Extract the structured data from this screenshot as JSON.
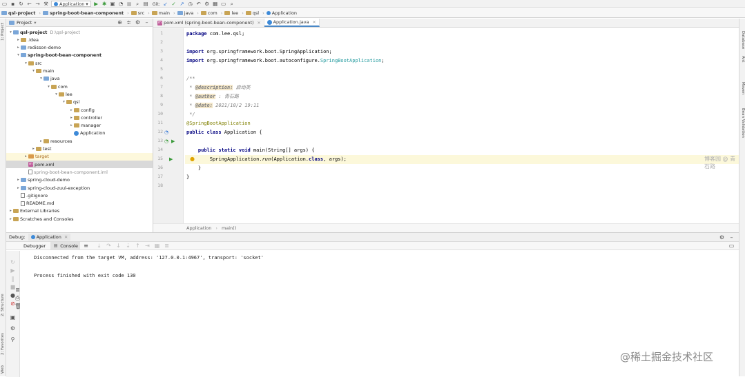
{
  "toolbar": {
    "run_config": "Application",
    "git_label": "Git:"
  },
  "navbar": {
    "crumbs": [
      "qsl-project",
      "spring-boot-bean-component",
      "src",
      "main",
      "java",
      "com",
      "lee",
      "qsl",
      "Application"
    ]
  },
  "project_panel": {
    "title": "Project",
    "tree": [
      {
        "label": "qsl-project",
        "sub": "D:\\qsl-project",
        "indent": 0,
        "arrow": "▾",
        "icon": "folder-blue",
        "bold": true
      },
      {
        "label": ".idea",
        "indent": 1,
        "arrow": "▸",
        "icon": "folder"
      },
      {
        "label": "redisson-demo",
        "indent": 1,
        "arrow": "▸",
        "icon": "folder-blue"
      },
      {
        "label": "spring-boot-bean-component",
        "indent": 1,
        "arrow": "▾",
        "icon": "folder-blue",
        "bold": true
      },
      {
        "label": "src",
        "indent": 2,
        "arrow": "▾",
        "icon": "folder"
      },
      {
        "label": "main",
        "indent": 3,
        "arrow": "▾",
        "icon": "folder"
      },
      {
        "label": "java",
        "indent": 4,
        "arrow": "▾",
        "icon": "folder-blue"
      },
      {
        "label": "com",
        "indent": 5,
        "arrow": "▾",
        "icon": "folder"
      },
      {
        "label": "lee",
        "indent": 6,
        "arrow": "▾",
        "icon": "folder"
      },
      {
        "label": "qsl",
        "indent": 7,
        "arrow": "▾",
        "icon": "folder"
      },
      {
        "label": "config",
        "indent": 8,
        "arrow": "▸",
        "icon": "folder"
      },
      {
        "label": "controller",
        "indent": 8,
        "arrow": "▸",
        "icon": "folder"
      },
      {
        "label": "manager",
        "indent": 8,
        "arrow": "▸",
        "icon": "folder"
      },
      {
        "label": "Application",
        "indent": 8,
        "arrow": "",
        "icon": "java"
      },
      {
        "label": "resources",
        "indent": 4,
        "arrow": "▸",
        "icon": "folder"
      },
      {
        "label": "test",
        "indent": 3,
        "arrow": "▸",
        "icon": "folder"
      },
      {
        "label": "target",
        "indent": 2,
        "arrow": "▸",
        "icon": "folder-orange",
        "style": "orange",
        "hl": true
      },
      {
        "label": "pom.xml",
        "indent": 2,
        "arrow": "",
        "icon": "maven",
        "sel": true
      },
      {
        "label": "spring-boot-bean-component.iml",
        "indent": 2,
        "arrow": "",
        "icon": "text",
        "style": "grey"
      },
      {
        "label": "spring-cloud-demo",
        "indent": 1,
        "arrow": "▸",
        "icon": "folder-blue"
      },
      {
        "label": "spring-cloud-zuul-exception",
        "indent": 1,
        "arrow": "▸",
        "icon": "folder-blue"
      },
      {
        "label": ".gitignore",
        "indent": 1,
        "arrow": "",
        "icon": "text"
      },
      {
        "label": "README.md",
        "indent": 1,
        "arrow": "",
        "icon": "text"
      },
      {
        "label": "External Libraries",
        "indent": 0,
        "arrow": "▸",
        "icon": "folder"
      },
      {
        "label": "Scratches and Consoles",
        "indent": 0,
        "arrow": "▸",
        "icon": "folder"
      }
    ]
  },
  "editor": {
    "tabs": [
      {
        "label": "pom.xml (spring-boot-bean-component)",
        "active": false
      },
      {
        "label": "Application.java",
        "active": true
      }
    ],
    "line_numbers": [
      "1",
      "2",
      "3",
      "4",
      "5",
      "6",
      "7",
      "8",
      "9",
      "10",
      "11",
      "12",
      "13",
      "14",
      "15",
      "16",
      "17",
      "18"
    ],
    "code": {
      "l1_kw": "package",
      "l1_rest": " com.lee.qsl;",
      "l3_kw": "import",
      "l3_rest": " org.springframework.boot.SpringApplication;",
      "l4_kw": "import",
      "l4_rest": " org.springframework.boot.autoconfigure.",
      "l4_type": "SpringBootApplication",
      "l4_end": ";",
      "l6": "/**",
      "l7_star": " * ",
      "l7_tag": "@description:",
      "l7_text": " 启动类",
      "l8_star": " * ",
      "l8_tag": "@author",
      "l8_text": " : 青石路",
      "l9_star": " * ",
      "l9_tag": "@date:",
      "l9_text": " 2021/10/2 19:11",
      "l10": " */",
      "l11": "@SpringBootApplication",
      "l12_kw": "public class",
      "l12_rest": " Application {",
      "l14_indent": "    ",
      "l14_kw": "public static void",
      "l14_rest": " main(String[] args) {",
      "l15_indent": "        ",
      "l15_a": "SpringApplication.",
      "l15_run": "run",
      "l15_b": "(Application.",
      "l15_kw": "class",
      "l15_c": ", args);",
      "l16": "    }",
      "l17": "}"
    },
    "breadcrumb": [
      "Application",
      "main()"
    ],
    "watermark": "博客园 @ 青石路"
  },
  "debug": {
    "label": "Debug:",
    "run_tab": "Application",
    "sub_tabs": [
      "Debugger",
      "Console"
    ],
    "console_lines": [
      "Disconnected from the target VM, address: '127.0.0.1:4967', transport: 'socket'",
      "Process finished with exit code 130"
    ]
  },
  "side_strips": {
    "left": [
      "1: Project",
      "2: Structure",
      "2: Favorites",
      "Web"
    ],
    "right": [
      "Database",
      "Ant",
      "Maven",
      "Bean Validation"
    ]
  },
  "watermark_bottom": "@稀土掘金技术社区"
}
